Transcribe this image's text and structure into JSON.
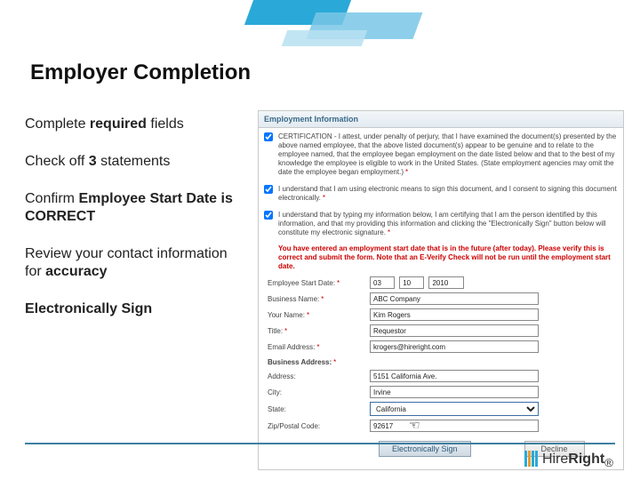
{
  "slide": {
    "title": "Employer Completion",
    "bullets": {
      "b1_a": "Complete ",
      "b1_b": "required",
      "b1_c": " fields",
      "b2_a": "Check off ",
      "b2_b": "3",
      "b2_c": " statements",
      "b3_a": "Confirm ",
      "b3_b": "Employee Start Date is CORRECT",
      "b4_a": "Review your contact information for ",
      "b4_b": "accuracy",
      "b5": "Electronically Sign"
    }
  },
  "panel": {
    "heading": "Employment Information",
    "cert1": "CERTIFICATION - I attest, under penalty of perjury, that I have examined the document(s) presented by the above named employee, that the above listed document(s) appear to be genuine and to relate to the employee named, that the employee began employment on the date listed below and that to the best of my knowledge the employee is eligible to work in the United States. (State employment agencies may omit the date the employee began employment.)",
    "cert2": "I understand that I am using electronic means to sign this document, and I consent to signing this document electronically.",
    "cert3": "I understand that by typing my information below, I am certifying that I am the person identified by this information, and that my providing this information and clicking the \"Electronically Sign\" button below will constitute my electronic signature.",
    "warning": "You have entered an employment start date that is in the future (after today). Please verify this is correct and submit the form. Note that an E-Verify Check will not be run until the employment start date.",
    "labels": {
      "start_date": "Employee Start Date:",
      "business": "Business Name:",
      "your_name": "Your Name:",
      "title": "Title:",
      "email": "Email Address:",
      "biz_addr": "Business Address:",
      "addr": "Address:",
      "city": "City:",
      "state": "State:",
      "zip": "Zip/Postal Code:"
    },
    "values": {
      "date_m": "03",
      "date_d": "10",
      "date_y": "2010",
      "business": "ABC Company",
      "your_name": "Kim Rogers",
      "title": "Requestor",
      "email": "krogers@hireright.com",
      "addr": "5151 California Ave.",
      "city": "Irvine",
      "state": "California",
      "zip": "92617"
    },
    "buttons": {
      "sign": "Electronically Sign",
      "decline": "Decline"
    }
  },
  "footer": {
    "brand_a": "Hire",
    "brand_b": "Right"
  },
  "icons": {
    "cursor": "hand-cursor-icon"
  }
}
